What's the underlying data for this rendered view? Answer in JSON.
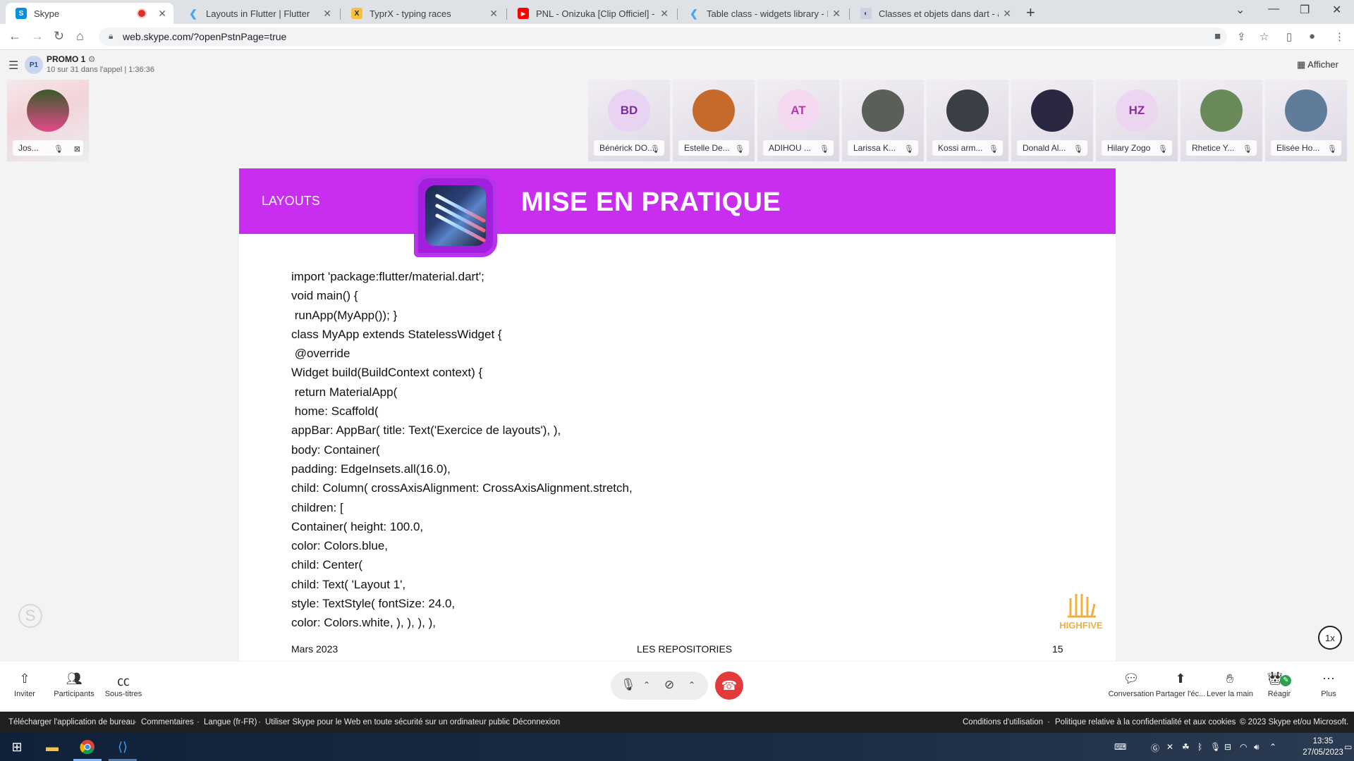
{
  "browser": {
    "tabs": [
      {
        "title": "Skype",
        "favicon": "skype-icon"
      },
      {
        "title": "Layouts in Flutter | Flutter",
        "favicon": "flutter-icon"
      },
      {
        "title": "TyprX - typing races",
        "favicon": "typrx-icon"
      },
      {
        "title": "PNL - Onizuka [Clip Officiel] - Par",
        "favicon": "youtube-icon"
      },
      {
        "title": "Table class - widgets library - Dar",
        "favicon": "flutter-icon"
      },
      {
        "title": "Classes et objets dans dart - apc",
        "favicon": "page-icon"
      }
    ],
    "url": "web.skype.com/?openPstnPage=true"
  },
  "call": {
    "group_initials": "P1",
    "group_name": "PROMO 1",
    "subtitle": "10 sur 31 dans l'appel | 1:36:36",
    "afficher": "Afficher"
  },
  "self_tile": {
    "name": "Jos..."
  },
  "participants": [
    {
      "initials": "BD",
      "name": "Bénérick DO...",
      "avatar_color": "#e9d3f2",
      "text_color": "#7a2c9a"
    },
    {
      "initials": "",
      "name": "Estelle De...",
      "avatar_color": "#c56a2a",
      "text_color": "#ffffff"
    },
    {
      "initials": "AT",
      "name": "ADIHOU ...",
      "avatar_color": "#f4d9f0",
      "text_color": "#b43aa6"
    },
    {
      "initials": "",
      "name": "Larissa K...",
      "avatar_color": "#5a5f5a",
      "text_color": "#ffffff"
    },
    {
      "initials": "",
      "name": "Kossi arm...",
      "avatar_color": "#3a3f45",
      "text_color": "#ffffff"
    },
    {
      "initials": "",
      "name": "Donald Al...",
      "avatar_color": "#2a2840",
      "text_color": "#ffffff"
    },
    {
      "initials": "HZ",
      "name": "Hilary Zogo",
      "avatar_color": "#ecd5f0",
      "text_color": "#8a2f9e"
    },
    {
      "initials": "",
      "name": "Rhetice Y...",
      "avatar_color": "#6a8a5a",
      "text_color": "#ffffff"
    },
    {
      "initials": "",
      "name": "Elisée Ho...",
      "avatar_color": "#5f7d9a",
      "text_color": "#ffffff"
    }
  ],
  "slide": {
    "section": "LAYOUTS",
    "title": "MISE EN PRATIQUE",
    "code_lines": [
      "import 'package:flutter/material.dart';",
      "void main() {",
      " runApp(MyApp()); }",
      "class MyApp extends StatelessWidget {",
      " @override",
      "Widget build(BuildContext context) {",
      " return MaterialApp(",
      " home: Scaffold(",
      "appBar: AppBar( title: Text('Exercice de layouts'), ),",
      "body: Container(",
      "padding: EdgeInsets.all(16.0),",
      "child: Column( crossAxisAlignment: CrossAxisAlignment.stretch,",
      "children: [",
      "Container( height: 100.0,",
      "color: Colors.blue,",
      "child: Center(",
      "child: Text( 'Layout 1',",
      "style: TextStyle( fontSize: 24.0,",
      "color: Colors.white, ), ), ), ),"
    ],
    "footer_left": "Mars 2023",
    "footer_center": "LES REPOSITORIES",
    "page_number": "15",
    "logo_text": "HIGHFIVE",
    "speed": "1x",
    "accent": "#c92df0"
  },
  "controls": {
    "left": [
      {
        "label": "Inviter",
        "icon": "share-icon"
      },
      {
        "label": "Participants",
        "icon": "people-icon"
      },
      {
        "label": "Sous-titres",
        "icon": "captions-icon"
      }
    ],
    "right": [
      {
        "label": "Conversation",
        "icon": "chat-icon"
      },
      {
        "label": "Partager l'éc...",
        "icon": "share-screen-icon"
      },
      {
        "label": "Lever la main",
        "icon": "raise-hand-icon"
      },
      {
        "label": "Réagir",
        "icon": "reaction-icon"
      },
      {
        "label": "Plus",
        "icon": "more-icon"
      }
    ]
  },
  "footer": {
    "left": [
      "Télécharger l'application de bureau",
      "Commentaires",
      "Langue (fr-FR)",
      "Utiliser Skype pour le Web en toute sécurité sur un ordinateur public",
      "Déconnexion"
    ],
    "right": [
      "Conditions d'utilisation",
      "Politique relative à la confidentialité et aux cookies",
      "© 2023 Skype et/ou Microsoft."
    ]
  },
  "taskbar": {
    "time": "13:35",
    "date": "27/05/2023"
  }
}
